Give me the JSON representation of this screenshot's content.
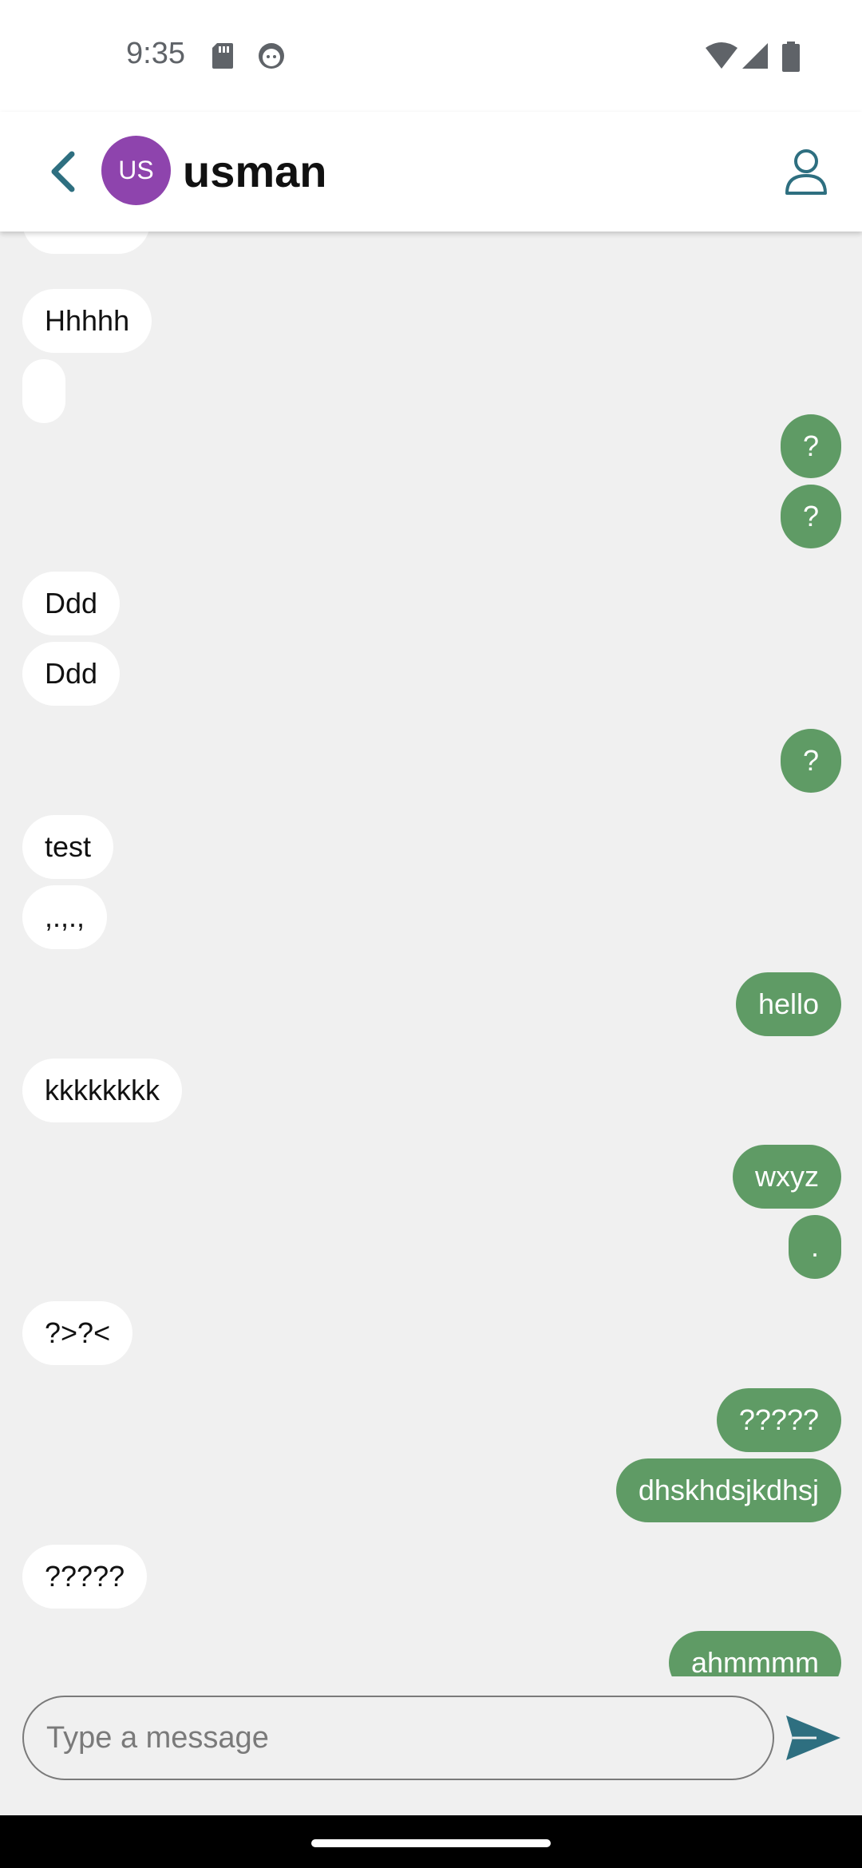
{
  "status": {
    "time": "9:35"
  },
  "header": {
    "avatar_initials": "US",
    "contact_name": "usman"
  },
  "messages": [
    {
      "text": "Hhhhh",
      "sender": "them"
    },
    {
      "text": "",
      "sender": "them"
    },
    {
      "text": "?",
      "sender": "me"
    },
    {
      "text": "?",
      "sender": "me"
    },
    {
      "text": "Ddd",
      "sender": "them"
    },
    {
      "text": "Ddd",
      "sender": "them"
    },
    {
      "text": "?",
      "sender": "me"
    },
    {
      "text": "test",
      "sender": "them"
    },
    {
      "text": ",.,.,",
      "sender": "them"
    },
    {
      "text": "hello",
      "sender": "me"
    },
    {
      "text": "kkkkkkkk",
      "sender": "them"
    },
    {
      "text": "wxyz",
      "sender": "me"
    },
    {
      "text": ".",
      "sender": "me"
    },
    {
      "text": "?>?<",
      "sender": "them"
    },
    {
      "text": "?????",
      "sender": "me"
    },
    {
      "text": "dhskhdsjkdhsj",
      "sender": "me"
    },
    {
      "text": "?????",
      "sender": "them"
    },
    {
      "text": "ahmmmm",
      "sender": "me"
    }
  ],
  "composer": {
    "placeholder": "Type a message"
  },
  "icons": {
    "back": "back-arrow-icon",
    "profile": "person-icon",
    "send": "send-icon",
    "wifi": "wifi-icon",
    "signal": "signal-icon",
    "battery": "battery-icon"
  },
  "colors": {
    "outgoing_bubble": "#5f9b65",
    "incoming_bubble": "#ffffff",
    "avatar": "#8e44ad",
    "accent": "#2e6f80"
  }
}
